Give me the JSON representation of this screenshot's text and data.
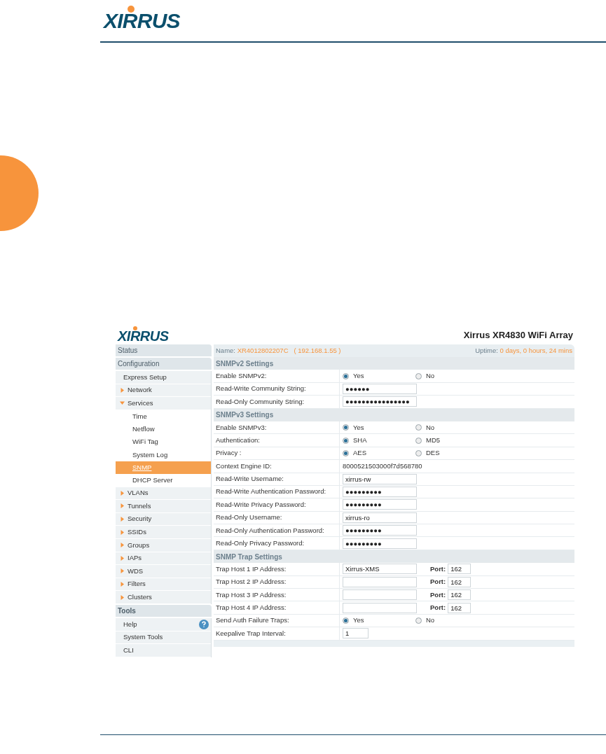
{
  "page_header": {
    "logo": "XIRRUS"
  },
  "screenshot": {
    "logo": "XIRRUS",
    "title": "Xirrus XR4830 WiFi Array",
    "sidebar": [
      {
        "title": "Status"
      },
      {
        "title": "Configuration",
        "items": [
          {
            "label": "Express Setup",
            "kind": "link"
          },
          {
            "label": "Network",
            "kind": "folder",
            "expanded": false
          },
          {
            "label": "Services",
            "kind": "folder",
            "expanded": true,
            "children": [
              {
                "label": "Time",
                "selected": false
              },
              {
                "label": "Netflow",
                "selected": false
              },
              {
                "label": "WiFi Tag",
                "selected": false
              },
              {
                "label": "System Log",
                "selected": false
              },
              {
                "label": "SNMP",
                "selected": true
              },
              {
                "label": "DHCP Server",
                "selected": false
              }
            ]
          },
          {
            "label": "VLANs",
            "kind": "folder",
            "expanded": false
          },
          {
            "label": "Tunnels",
            "kind": "folder",
            "expanded": false
          },
          {
            "label": "Security",
            "kind": "folder",
            "expanded": false
          },
          {
            "label": "SSIDs",
            "kind": "folder",
            "expanded": false
          },
          {
            "label": "Groups",
            "kind": "folder",
            "expanded": false
          },
          {
            "label": "IAPs",
            "kind": "folder",
            "expanded": false
          },
          {
            "label": "WDS",
            "kind": "folder",
            "expanded": false
          },
          {
            "label": "Filters",
            "kind": "folder",
            "expanded": false
          },
          {
            "label": "Clusters",
            "kind": "folder",
            "expanded": false
          }
        ]
      },
      {
        "title": "Tools",
        "items": [
          {
            "label": "Help",
            "kind": "help"
          },
          {
            "label": "System Tools",
            "kind": "link"
          },
          {
            "label": "CLI",
            "kind": "link"
          }
        ]
      }
    ],
    "status": {
      "name_label": "Name:",
      "name_value": "XR4012802207C",
      "ip": "( 192.168.1.55 )",
      "uptime_label": "Uptime:",
      "uptime_value": "0 days, 0 hours, 24 mins"
    },
    "sections": [
      {
        "title": "SNMPv2 Settings",
        "rows": [
          {
            "label": "Enable SNMPv2:",
            "kind": "radio",
            "options": [
              {
                "label": "Yes",
                "selected": true
              },
              {
                "label": "No",
                "selected": false
              }
            ]
          },
          {
            "label": "Read-Write Community String:",
            "kind": "field",
            "value": "●●●●●●"
          },
          {
            "label": "Read-Only Community String:",
            "kind": "field",
            "value": "●●●●●●●●●●●●●●●●"
          }
        ]
      },
      {
        "title": "SNMPv3 Settings",
        "rows": [
          {
            "label": "Enable SNMPv3:",
            "kind": "radio",
            "options": [
              {
                "label": "Yes",
                "selected": true
              },
              {
                "label": "No",
                "selected": false
              }
            ]
          },
          {
            "label": "Authentication:",
            "kind": "radio",
            "options": [
              {
                "label": "SHA",
                "selected": true
              },
              {
                "label": "MD5",
                "selected": false
              }
            ]
          },
          {
            "label": "Privacy :",
            "kind": "radio",
            "options": [
              {
                "label": "AES",
                "selected": true
              },
              {
                "label": "DES",
                "selected": false
              }
            ]
          },
          {
            "label": "Context Engine ID:",
            "kind": "static",
            "value": "8000521503000f7d568780"
          },
          {
            "label": "Read-Write Username:",
            "kind": "field",
            "value": "xirrus-rw"
          },
          {
            "label": "Read-Write Authentication Password:",
            "kind": "field",
            "value": "●●●●●●●●●"
          },
          {
            "label": "Read-Write Privacy Password:",
            "kind": "field",
            "value": "●●●●●●●●●"
          },
          {
            "label": "Read-Only Username:",
            "kind": "field",
            "value": "xirrus-ro"
          },
          {
            "label": "Read-Only Authentication Password:",
            "kind": "field",
            "value": "●●●●●●●●●"
          },
          {
            "label": "Read-Only Privacy Password:",
            "kind": "field",
            "value": "●●●●●●●●●"
          }
        ]
      },
      {
        "title": "SNMP Trap Settings",
        "rows": [
          {
            "label": "Trap Host 1 IP Address:",
            "kind": "trap",
            "value": "Xirrus-XMS",
            "port_label": "Port:",
            "port_value": "162"
          },
          {
            "label": "Trap Host 2 IP Address:",
            "kind": "trap",
            "port_label": "Port:",
            "port_value": "162"
          },
          {
            "label": "Trap Host 3 IP Address:",
            "kind": "trap",
            "port_label": "Port:",
            "port_value": "162"
          },
          {
            "label": "Trap Host 4 IP Address:",
            "kind": "trap",
            "port_label": "Port:",
            "port_value": "162"
          },
          {
            "label": "Send Auth Failure Traps:",
            "kind": "radio",
            "options": [
              {
                "label": "Yes",
                "selected": true
              },
              {
                "label": "No",
                "selected": false
              }
            ]
          },
          {
            "label": "Keepalive Trap Interval:",
            "kind": "short",
            "value": "1"
          }
        ]
      }
    ]
  }
}
